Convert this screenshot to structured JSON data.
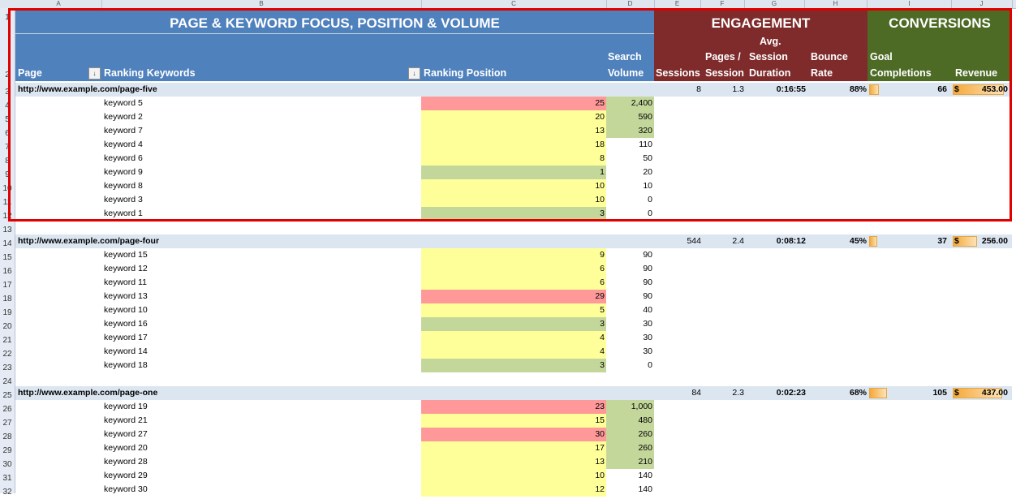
{
  "columns": [
    "A",
    "B",
    "C",
    "D",
    "E",
    "F",
    "G",
    "H",
    "I",
    "J"
  ],
  "row_numbers": [
    "1",
    "2",
    "3",
    "4",
    "5",
    "6",
    "7",
    "8",
    "9",
    "10",
    "11",
    "12",
    "13",
    "14",
    "15",
    "16",
    "17",
    "18",
    "19",
    "20",
    "21",
    "22",
    "23",
    "24",
    "25",
    "26",
    "27",
    "28",
    "29",
    "30",
    "31",
    "32"
  ],
  "header": {
    "band_title": "PAGE & KEYWORD FOCUS, POSITION & VOLUME",
    "engagement_title": "ENGAGEMENT",
    "conversions_title": "CONVERSIONS",
    "page": "Page",
    "ranking_keywords": "Ranking Keywords",
    "ranking_position": "Ranking Position",
    "search_l1": "Search",
    "search_l2": "Volume",
    "sessions": "Sessions",
    "pages_l1": "Pages /",
    "pages_l2": "Session",
    "avg_l1": "Avg.",
    "avg_l2": "Session",
    "avg_l3": "Duration",
    "bounce_l1": "Bounce",
    "bounce_l2": "Rate",
    "goal_l1": "Goal",
    "goal_l2": "Completions",
    "revenue": "Revenue",
    "filter_glyph": "↓"
  },
  "currency_symbol": "$",
  "groups": [
    {
      "url": "http://www.example.com/page-five",
      "sessions": "8",
      "pages_per_session": "1.3",
      "avg_duration": "0:16:55",
      "bounce": "88%",
      "goal_completions": "66",
      "revenue": "453.00",
      "goal_fill": 0.12,
      "revenue_fill": 0.95,
      "keywords": [
        {
          "name": "keyword 5",
          "position": "25",
          "volume": "2,400",
          "pcolor": "red",
          "vcolor": "green"
        },
        {
          "name": "keyword 2",
          "position": "20",
          "volume": "590",
          "pcolor": "yellow",
          "vcolor": "green"
        },
        {
          "name": "keyword 7",
          "position": "13",
          "volume": "320",
          "pcolor": "yellow",
          "vcolor": "green"
        },
        {
          "name": "keyword 4",
          "position": "18",
          "volume": "110",
          "pcolor": "yellow",
          "vcolor": ""
        },
        {
          "name": "keyword 6",
          "position": "8",
          "volume": "50",
          "pcolor": "yellow",
          "vcolor": ""
        },
        {
          "name": "keyword 9",
          "position": "1",
          "volume": "20",
          "pcolor": "green",
          "vcolor": ""
        },
        {
          "name": "keyword 8",
          "position": "10",
          "volume": "10",
          "pcolor": "yellow",
          "vcolor": ""
        },
        {
          "name": "keyword 3",
          "position": "10",
          "volume": "0",
          "pcolor": "yellow",
          "vcolor": ""
        },
        {
          "name": "keyword 1",
          "position": "3",
          "volume": "0",
          "pcolor": "green",
          "vcolor": ""
        }
      ]
    },
    {
      "url": "http://www.example.com/page-four",
      "sessions": "544",
      "pages_per_session": "2.4",
      "avg_duration": "0:08:12",
      "bounce": "45%",
      "goal_completions": "37",
      "revenue": "256.00",
      "goal_fill": 0.1,
      "revenue_fill": 0.45,
      "keywords": [
        {
          "name": "keyword 15",
          "position": "9",
          "volume": "90",
          "pcolor": "yellow",
          "vcolor": ""
        },
        {
          "name": "keyword 12",
          "position": "6",
          "volume": "90",
          "pcolor": "yellow",
          "vcolor": ""
        },
        {
          "name": "keyword 11",
          "position": "6",
          "volume": "90",
          "pcolor": "yellow",
          "vcolor": ""
        },
        {
          "name": "keyword 13",
          "position": "29",
          "volume": "90",
          "pcolor": "red",
          "vcolor": ""
        },
        {
          "name": "keyword 10",
          "position": "5",
          "volume": "40",
          "pcolor": "yellow",
          "vcolor": ""
        },
        {
          "name": "keyword 16",
          "position": "3",
          "volume": "30",
          "pcolor": "green",
          "vcolor": ""
        },
        {
          "name": "keyword 17",
          "position": "4",
          "volume": "30",
          "pcolor": "yellow",
          "vcolor": ""
        },
        {
          "name": "keyword 14",
          "position": "4",
          "volume": "30",
          "pcolor": "yellow",
          "vcolor": ""
        },
        {
          "name": "keyword 18",
          "position": "3",
          "volume": "0",
          "pcolor": "green",
          "vcolor": ""
        }
      ]
    },
    {
      "url": "http://www.example.com/page-one",
      "sessions": "84",
      "pages_per_session": "2.3",
      "avg_duration": "0:02:23",
      "bounce": "68%",
      "goal_completions": "105",
      "revenue": "437.00",
      "goal_fill": 0.22,
      "revenue_fill": 0.92,
      "keywords": [
        {
          "name": "keyword 19",
          "position": "23",
          "volume": "1,000",
          "pcolor": "red",
          "vcolor": "green"
        },
        {
          "name": "keyword 21",
          "position": "15",
          "volume": "480",
          "pcolor": "yellow",
          "vcolor": "green"
        },
        {
          "name": "keyword 27",
          "position": "30",
          "volume": "260",
          "pcolor": "red",
          "vcolor": "green"
        },
        {
          "name": "keyword 20",
          "position": "17",
          "volume": "260",
          "pcolor": "yellow",
          "vcolor": "green"
        },
        {
          "name": "keyword 28",
          "position": "13",
          "volume": "210",
          "pcolor": "yellow",
          "vcolor": "green"
        },
        {
          "name": "keyword 29",
          "position": "10",
          "volume": "140",
          "pcolor": "yellow",
          "vcolor": ""
        },
        {
          "name": "keyword 30",
          "position": "12",
          "volume": "140",
          "pcolor": "yellow",
          "vcolor": ""
        }
      ]
    }
  ],
  "colors": {
    "blue_band": "#4f81bd",
    "engagement_band": "#7f2b2b",
    "conversions_band": "#4e6b26",
    "page_row": "#dce6f1",
    "red": "#ff9999",
    "yellow": "#ffff99",
    "green": "#c4d79b",
    "selection_border": "#e00000"
  }
}
